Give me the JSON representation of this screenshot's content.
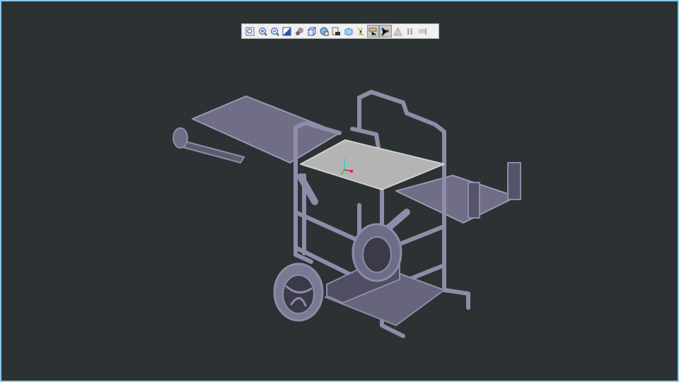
{
  "toolbar": {
    "buttons": [
      {
        "icon": "zoom-fit-icon",
        "active": false
      },
      {
        "icon": "zoom-in-icon",
        "active": false
      },
      {
        "icon": "zoom-out-icon",
        "active": false
      },
      {
        "icon": "view-normal-icon",
        "active": false
      },
      {
        "icon": "shading-icon",
        "active": false
      },
      {
        "icon": "view-cube-icon",
        "active": false
      },
      {
        "icon": "named-views-icon",
        "active": false
      },
      {
        "icon": "snapshot-icon",
        "active": false
      },
      {
        "icon": "transparency-icon",
        "active": false
      },
      {
        "icon": "spin-center-icon",
        "active": false
      },
      {
        "icon": "annotation-display-icon",
        "active": true
      },
      {
        "icon": "assembly-tree-icon",
        "active": true
      },
      {
        "icon": "warning-icon",
        "active": false
      },
      {
        "icon": "pause-icon",
        "active": false
      },
      {
        "icon": "next-step-icon",
        "active": false
      }
    ]
  },
  "colors": {
    "background": "#2c3233",
    "model": "#8e8ca8",
    "frame_border": "#8cc8ec",
    "selected_panel": "#b4b4b4"
  }
}
